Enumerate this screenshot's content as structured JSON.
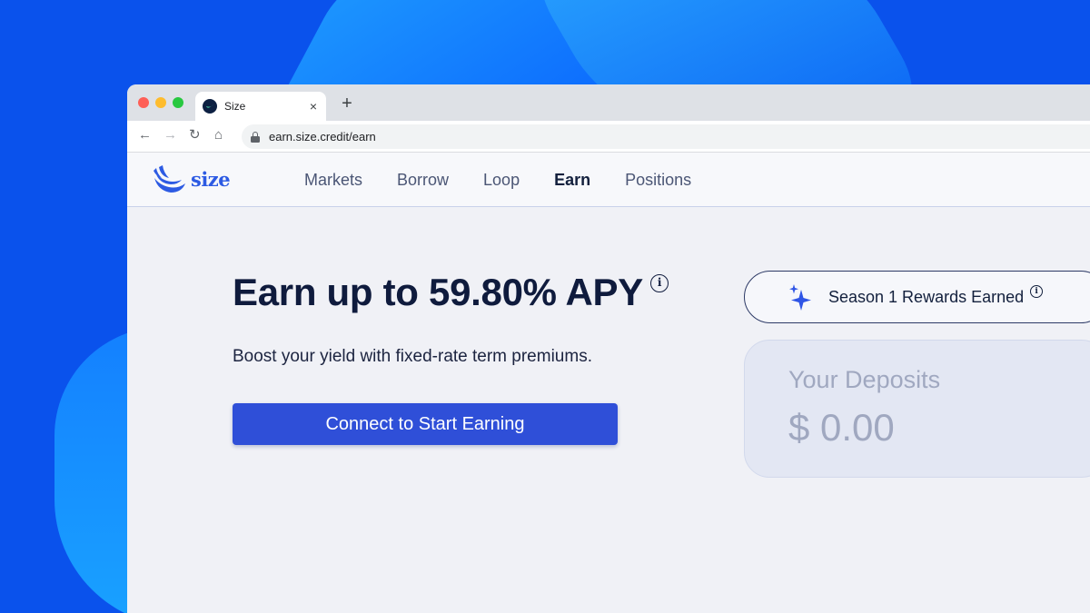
{
  "browser": {
    "tab_title": "Size",
    "tab_close": "×",
    "new_tab": "+",
    "url": "earn.size.credit/earn",
    "controls": {
      "back": "←",
      "forward": "→",
      "reload": "↻",
      "home": "⌂"
    }
  },
  "site": {
    "logo_text": "size",
    "nav": [
      {
        "label": "Markets",
        "active": false
      },
      {
        "label": "Borrow",
        "active": false
      },
      {
        "label": "Loop",
        "active": false
      },
      {
        "label": "Earn",
        "active": true
      },
      {
        "label": "Positions",
        "active": false
      }
    ]
  },
  "hero": {
    "headline": "Earn up to 59.80% APY",
    "info": "i",
    "subtitle": "Boost your yield with fixed-rate term premiums.",
    "cta_label": "Connect to Start Earning"
  },
  "rewards": {
    "label": "Season 1 Rewards Earned",
    "info": "i",
    "icon": "sparkle-icon"
  },
  "deposits": {
    "label": "Your Deposits",
    "value": "$ 0.00"
  },
  "colors": {
    "background": "#0a52ec",
    "brand": "#2d5be3",
    "cta": "#2f4fd8",
    "text_dark": "#0f1b3d"
  }
}
